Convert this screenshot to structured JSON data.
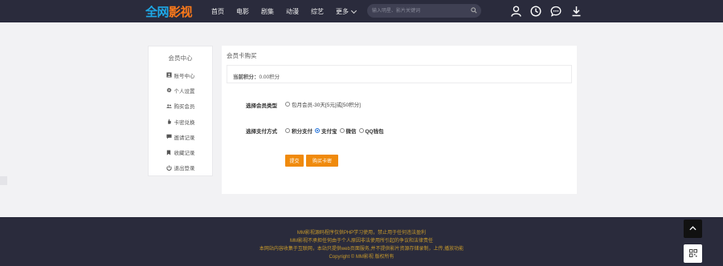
{
  "header": {
    "logo_left": "全网",
    "logo_right": "影视",
    "nav": [
      "首页",
      "电影",
      "剧集",
      "动漫",
      "综艺"
    ],
    "nav_more": "更多",
    "search_placeholder": "输入明星、影片关键词"
  },
  "sidebar": {
    "title": "会员中心",
    "items": [
      {
        "label": "账号中心",
        "icon": "id-card-icon"
      },
      {
        "label": "个人设置",
        "icon": "gear-icon"
      },
      {
        "label": "购买会员",
        "icon": "users-icon"
      },
      {
        "label": "卡密兑换",
        "icon": "hand-icon"
      },
      {
        "label": "邀请记录",
        "icon": "comment-icon"
      },
      {
        "label": "收藏记录",
        "icon": "bookmark-icon"
      },
      {
        "label": "退出登录",
        "icon": "power-icon"
      }
    ]
  },
  "panel": {
    "title": "会员卡购买",
    "points_label": "当前积分：",
    "points_value": "0.00积分",
    "member_type_label": "选择会员类型",
    "member_option": "包月会员-30天[5元]或[50积分]",
    "pay_label": "选择支付方式",
    "pay_options": [
      "积分支付",
      "支付宝",
      "微信",
      "QQ钱包"
    ],
    "pay_selected": "支付宝",
    "submit_label": "提交",
    "buy_card_label": "购买卡密"
  },
  "footer": {
    "line1": "MM影视源码程序仅供PHP学习使用，禁止用于任何违法盈利",
    "line2": "MM影视不承担任何由于个人原因非法使用所引起的争议和法律责任",
    "line3_prefix": "本网站内容收集于互联网，本站只提供web页面服务,并不提供影片资源存储录制，上传,播放功能",
    "line4": "Copyright ©  MM影视 版权所有"
  },
  "colors": {
    "header_bg": "#2a2b3c",
    "logo_blue": "#1ea8e6",
    "logo_orange": "#ff7a1a",
    "accent_button": "#f08a0c",
    "footer_text": "#c89a2b"
  }
}
